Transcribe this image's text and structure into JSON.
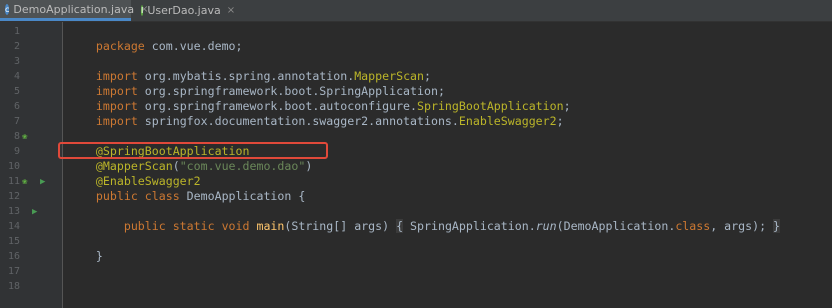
{
  "tabs": [
    {
      "label": "DemoApplication.java",
      "icon": "java-class-icon",
      "active": true
    },
    {
      "label": "UserDao.java",
      "icon": "java-interface-icon",
      "active": false
    }
  ],
  "line_numbers": [
    "1",
    "2",
    "3",
    "4",
    "5",
    "6",
    "7",
    "8",
    "9",
    "10",
    "11",
    "12",
    "13",
    "14",
    "15",
    "16",
    "17",
    "18"
  ],
  "code": {
    "l1": {
      "kw": "package",
      "rest": " com.vue.demo;"
    },
    "l3": {
      "kw": "import",
      "pre": " org.mybatis.spring.annotation.",
      "cls": "MapperScan",
      "post": ";"
    },
    "l4": {
      "kw": "import",
      "pre": " org.springframework.boot.SpringApplication;"
    },
    "l5": {
      "kw": "import",
      "pre": " org.springframework.boot.autoconfigure.",
      "cls": "SpringBootApplication",
      "post": ";"
    },
    "l6": {
      "kw": "import",
      "pre": " springfox.documentation.swagger2.annotations.",
      "cls": "EnableSwagger2",
      "post": ";"
    },
    "l8": {
      "ann": "@SpringBootApplication"
    },
    "l9": {
      "ann": "@MapperScan",
      "open": "(",
      "str": "\"com.vue.demo.dao\"",
      "close": ")"
    },
    "l10": {
      "ann": "@EnableSwagger2"
    },
    "l11": {
      "kw": "public class",
      "rest": " DemoApplication {"
    },
    "l13": {
      "indent": "    ",
      "kw": "public static void",
      "fn": " main",
      "args": "(String[] args) ",
      "bopen": "{",
      "body1": " SpringApplication.",
      "run": "run",
      "body2": "(DemoApplication.",
      "classkw": "class",
      "body3": ", args); ",
      "bclose": "}"
    },
    "l15": {
      "rest": "}"
    }
  },
  "colors": {
    "background": "#2b2b2b",
    "keyword": "#cc7832",
    "annotation": "#bbb529",
    "string": "#6a8759",
    "highlight_box": "#e0493a"
  }
}
